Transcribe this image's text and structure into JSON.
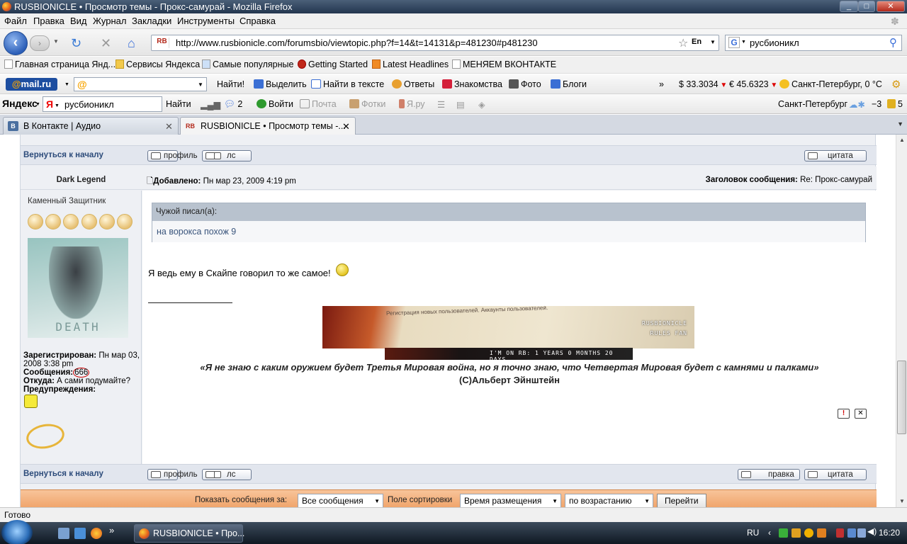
{
  "window": {
    "title": "RUSBIONICLE • Просмотр темы - Прокс-самурай - Mozilla Firefox",
    "controls": [
      "minimize",
      "maximize",
      "close"
    ]
  },
  "menu": [
    "Файл",
    "Правка",
    "Вид",
    "Журнал",
    "Закладки",
    "Инструменты",
    "Справка"
  ],
  "nav": {
    "url": "http://www.rusbionicle.com/forumsbio/viewtopic.php?f=14&t=14131&p=481230#p481230",
    "site_icon_label": "RB",
    "lang_badge": "En",
    "search_engine": "G",
    "search_value": "русбионикл"
  },
  "bookmarks": [
    {
      "label": "Главная страница Янд...",
      "icon": "page-icon"
    },
    {
      "label": "Сервисы Яндекса",
      "icon": "folder-icon"
    },
    {
      "label": "Самые популярные",
      "icon": "star-icon"
    },
    {
      "label": "Getting Started",
      "icon": "firefox-icon"
    },
    {
      "label": "Latest Headlines",
      "icon": "rss-icon"
    },
    {
      "label": "МЕНЯЕМ ВКОНТАКТЕ",
      "icon": "page-icon"
    }
  ],
  "mailru_bar": {
    "logo_prefix": "@",
    "logo_text": "mail.ru",
    "find_button": "Найти!",
    "items": [
      "Выделить",
      "Найти в тексте",
      "Ответы",
      "Знакомства",
      "Фото",
      "Блоги"
    ],
    "overflow": "»",
    "usd": "$ 33.3034",
    "eur": "€ 45.6323",
    "weather": "Санкт-Петербург, 0 °C"
  },
  "yandex_bar": {
    "logo": "Яндекс",
    "search_value": "русбионикл",
    "find_button": "Найти",
    "messages_count": "2",
    "login": "Войти",
    "mail": "Почта",
    "photos": "Фотки",
    "yaru": "Я.ру",
    "city": "Санкт-Петербург",
    "temp": "−3",
    "mail_count": "5"
  },
  "tabs": [
    {
      "title": "В Контакте | Аудио",
      "active": false,
      "icon_label": "B"
    },
    {
      "title": "RUSBIONICLE • Просмотр темы -...",
      "active": true,
      "icon_label": "RB"
    }
  ],
  "forum": {
    "back_to_top": "Вернуться к началу",
    "profile_button": "профиль",
    "pm_button": "лс",
    "quote_button": "цитата",
    "edit_button": "правка",
    "post": {
      "author": "Dark Legend",
      "posted_label": "Добавлено:",
      "posted_date": "Пн мар 23, 2009 4:19 pm",
      "subject_label": "Заголовок сообщения:",
      "subject": "Re: Прокс-самурай",
      "rank": "Каменный Защитник",
      "avatar_caption": "DEATH",
      "registered_label": "Зарегистрирован:",
      "registered": "Пн мар 03, 2008 3:38 pm",
      "messages_label": "Сообщения:",
      "messages": "666",
      "from_label": "Откуда:",
      "from": "А сами подумайте?",
      "warnings_label": "Предупреждения:",
      "quote_header": "Чужой писал(а):",
      "quote_body": "на ворокса похож 9",
      "text": "Я ведь ему в Скайпе говорил то же самое!",
      "banner_text": "Регистрация новых пользователей. Аккаунты пользователей.",
      "banner_rn1": "RUSBIONICLE",
      "banner_rn2": "RULES FAN",
      "banner_strip": "I'M ON RB: 1 YEARS 0 MONTHS 20 DAYS",
      "signature_quote": "«Я не знаю с каким оружием будет Третья Мировая война, но я точно знаю, что Четвертая Мировая будет с камнями и палками»",
      "signature_author": "(С)Альберт Эйнштейн",
      "report_button": "!",
      "delete_button": "✕"
    },
    "filter": {
      "show_label": "Показать сообщения за:",
      "show_value": "Все сообщения",
      "sort_label": "Поле сортировки",
      "sort_value": "Время размещения",
      "order_value": "по возрастанию",
      "go_button": "Перейти"
    }
  },
  "status": "Готово",
  "taskbar": {
    "task": "RUSBIONICLE • Про...",
    "lang": "RU",
    "time": "16:20"
  }
}
